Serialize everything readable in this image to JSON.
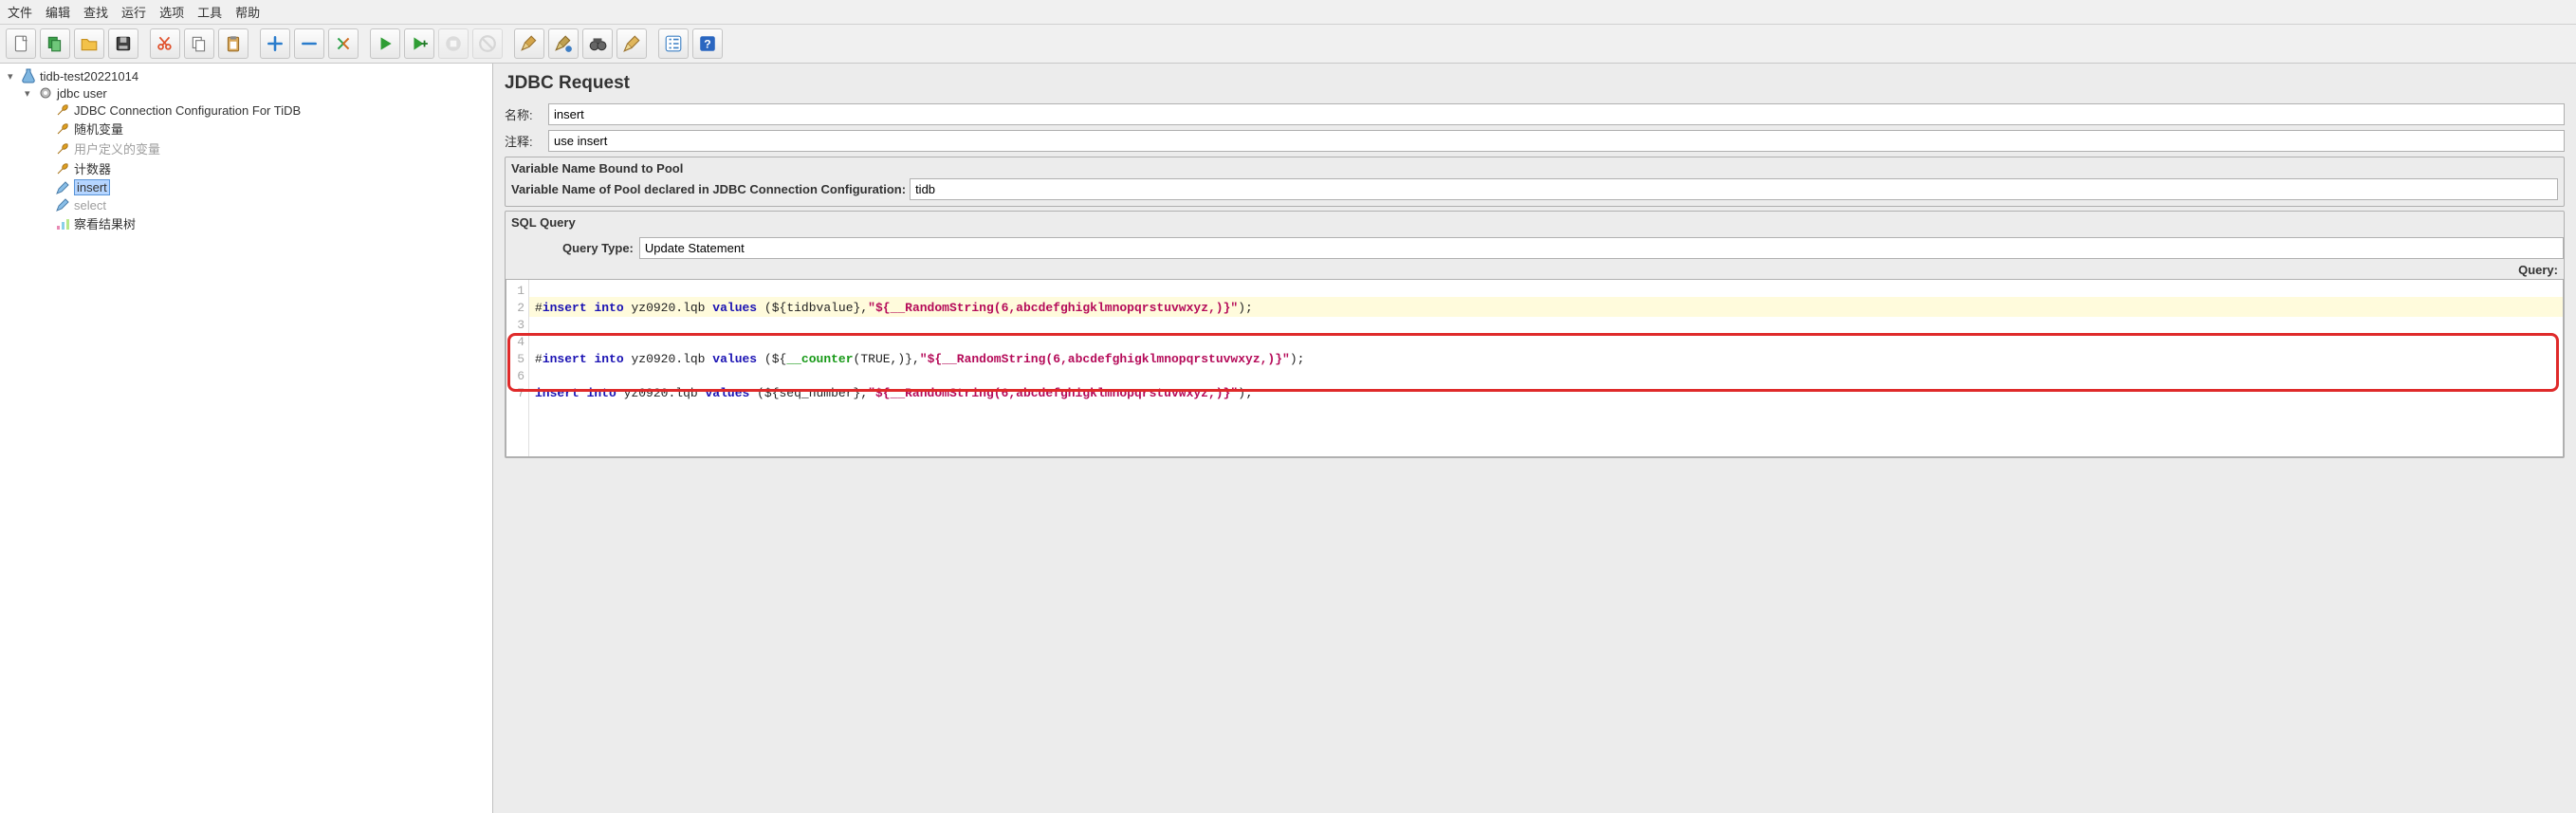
{
  "menu": [
    "文件",
    "编辑",
    "查找",
    "运行",
    "选项",
    "工具",
    "帮助"
  ],
  "toolbar_groups": [
    [
      {
        "name": "new-icon",
        "svg": "doc",
        "color": "#7a7a7a",
        "title": "New"
      },
      {
        "name": "templates-icon",
        "svg": "tpl",
        "color": "#27a349",
        "title": "Templates"
      },
      {
        "name": "open-icon",
        "svg": "folder",
        "color": "#e6a41d",
        "title": "Open"
      },
      {
        "name": "save-icon",
        "svg": "disk",
        "color": "#3d3d3d",
        "title": "Save"
      }
    ],
    [
      {
        "name": "cut-icon",
        "svg": "scissors",
        "color": "#e0502b",
        "title": "Cut"
      },
      {
        "name": "copy-icon",
        "svg": "copy",
        "color": "#7a7a7a",
        "title": "Copy"
      },
      {
        "name": "paste-icon",
        "svg": "clipboard",
        "color": "#b57a2a",
        "title": "Paste"
      }
    ],
    [
      {
        "name": "expand-icon",
        "svg": "plus",
        "color": "#2a7ccc",
        "title": "Expand"
      },
      {
        "name": "collapse-icon",
        "svg": "minus",
        "color": "#2a7ccc",
        "title": "Collapse"
      },
      {
        "name": "toggle-icon",
        "svg": "toggle",
        "color": "#2aa048",
        "title": "Toggle"
      }
    ],
    [
      {
        "name": "start-icon",
        "svg": "play",
        "color": "#2f9d34",
        "title": "Start"
      },
      {
        "name": "start-no-pauses-icon",
        "svg": "playplus",
        "color": "#2f9d34",
        "title": "Start no pauses"
      },
      {
        "name": "stop-icon",
        "svg": "stop",
        "color": "#aaaaaa",
        "title": "Stop",
        "disabled": true
      },
      {
        "name": "shutdown-icon",
        "svg": "shutdown",
        "color": "#aaaaaa",
        "title": "Shutdown",
        "disabled": true
      }
    ],
    [
      {
        "name": "clear-icon",
        "svg": "broom1",
        "color": "#c99b42",
        "title": "Clear"
      },
      {
        "name": "clear-all-icon",
        "svg": "broom2",
        "color": "#c99b42",
        "title": "Clear all"
      },
      {
        "name": "search-icon",
        "svg": "binoc",
        "color": "#555",
        "title": "Search"
      },
      {
        "name": "reset-search-icon",
        "svg": "broom3",
        "color": "#d2a03a",
        "title": "Reset search"
      }
    ],
    [
      {
        "name": "function-helper-icon",
        "svg": "fn",
        "color": "#3b7fc4",
        "title": "Function helper"
      },
      {
        "name": "help-icon",
        "svg": "help",
        "color": "#2a66c0",
        "title": "Help"
      }
    ]
  ],
  "tree": {
    "root": {
      "label": "tidb-test20221014"
    },
    "thread_group": {
      "label": "jdbc user"
    },
    "children": [
      {
        "label": "JDBC Connection Configuration For TiDB",
        "icon": "wrench",
        "name": "tree-jdbc-connection",
        "disabled": false
      },
      {
        "label": "随机变量",
        "icon": "wrench",
        "name": "tree-random-var",
        "disabled": false
      },
      {
        "label": "用户定义的变量",
        "icon": "wrench",
        "name": "tree-user-vars",
        "disabled": true
      },
      {
        "label": "计数器",
        "icon": "wrench",
        "name": "tree-counter",
        "disabled": false
      },
      {
        "label": "insert",
        "icon": "pencil",
        "name": "tree-insert",
        "selected": true,
        "disabled": false
      },
      {
        "label": "select",
        "icon": "pencil",
        "name": "tree-select",
        "disabled": true
      },
      {
        "label": "察看结果树",
        "icon": "chart",
        "name": "tree-results",
        "disabled": false
      }
    ]
  },
  "panel": {
    "title": "JDBC Request",
    "name_label": "名称:",
    "name_value": "insert",
    "comment_label": "注释:",
    "comment_value": "use insert",
    "pool_section_title": "Variable Name Bound to Pool",
    "pool_label": "Variable Name of Pool declared in JDBC Connection Configuration:",
    "pool_value": "tidb",
    "sql_section_title": "SQL Query",
    "query_type_label": "Query Type:",
    "query_type_value": "Update Statement",
    "query_label": "Query:",
    "lines": [
      1,
      2,
      3,
      4,
      5,
      6,
      7
    ],
    "code": {
      "l1": {
        "prefix": "#",
        "kw1": "insert",
        "kw2": "into",
        "tbl": "yz0920.lqb",
        "kw3": "values",
        "open": " (${tidbvalue},",
        "str": "\"${__RandomString(6,abcdefghigklmnopqrstuvwxyz,)}\"",
        "close": ");"
      },
      "l3": {
        "prefix": "#",
        "kw1": "insert",
        "kw2": "into",
        "tbl": "yz0920.lqb",
        "kw3": "values",
        "open": " (${",
        "fn": "__counter",
        "mid": "(TRUE,)},",
        "str": "\"${__RandomString(6,abcdefghigklmnopqrstuvwxyz,)}\"",
        "close": ");"
      },
      "l5": {
        "kw1": "insert",
        "kw2": "into",
        "tbl": "yz0920.lqb",
        "kw3": "values",
        "open": " (${seq_number},",
        "str": "\"${__RandomString(6,abcdefghigklmnopqrstuvwxyz,)}\"",
        "close": ");"
      }
    }
  }
}
